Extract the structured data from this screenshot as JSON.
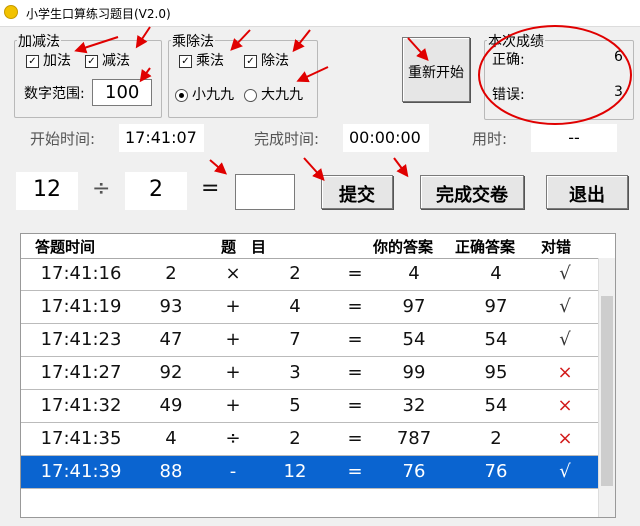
{
  "window": {
    "title": "小学生口算练习题目(V2.0)"
  },
  "addsub": {
    "group_title": "加减法",
    "add_label": "加法",
    "add_checked": true,
    "sub_label": "减法",
    "sub_checked": true,
    "range_label": "数字范围:",
    "range_value": "100"
  },
  "muldiv": {
    "group_title": "乘除法",
    "mul_label": "乘法",
    "mul_checked": true,
    "div_label": "除法",
    "div_checked": true,
    "small_label": "小九九",
    "small_selected": true,
    "big_label": "大九九",
    "big_selected": false
  },
  "restart_label": "重新开始",
  "score": {
    "group_title": "本次成绩",
    "correct_label": "正确:",
    "correct_value": "6",
    "wrong_label": "错误:",
    "wrong_value": "3"
  },
  "times": {
    "start_label": "开始时间:",
    "start_value": "17:41:07",
    "finish_label": "完成时间:",
    "finish_value": "00:00:00",
    "used_label": "用时:",
    "used_value": "--"
  },
  "question": {
    "a": "12",
    "op": "÷",
    "b": "2",
    "eq": "=",
    "answer": ""
  },
  "buttons": {
    "submit": "提交",
    "finish": "完成交卷",
    "exit": "退出"
  },
  "table": {
    "headers": {
      "time": "答题时间",
      "question": "题　目",
      "your_answer": "你的答案",
      "correct_answer": "正确答案",
      "result": "对错"
    },
    "rows": [
      {
        "time": "17:41:16",
        "a": "2",
        "op": "×",
        "b": "2",
        "eq": "=",
        "ans": "4",
        "correct": "4",
        "mark": "√",
        "right": true
      },
      {
        "time": "17:41:19",
        "a": "93",
        "op": "+",
        "b": "4",
        "eq": "=",
        "ans": "97",
        "correct": "97",
        "mark": "√",
        "right": true
      },
      {
        "time": "17:41:23",
        "a": "47",
        "op": "+",
        "b": "7",
        "eq": "=",
        "ans": "54",
        "correct": "54",
        "mark": "√",
        "right": true
      },
      {
        "time": "17:41:27",
        "a": "92",
        "op": "+",
        "b": "3",
        "eq": "=",
        "ans": "99",
        "correct": "95",
        "mark": "×",
        "right": false
      },
      {
        "time": "17:41:32",
        "a": "49",
        "op": "+",
        "b": "5",
        "eq": "=",
        "ans": "32",
        "correct": "54",
        "mark": "×",
        "right": false
      },
      {
        "time": "17:41:35",
        "a": "4",
        "op": "÷",
        "b": "2",
        "eq": "=",
        "ans": "787",
        "correct": "2",
        "mark": "×",
        "right": false
      },
      {
        "time": "17:41:39",
        "a": "88",
        "op": "-",
        "b": "12",
        "eq": "=",
        "ans": "76",
        "correct": "76",
        "mark": "√",
        "right": true,
        "selected": true
      }
    ]
  },
  "colors": {
    "annotation": "#e00000",
    "selection": "#0a64d0",
    "wrong_mark": "#d21a1a"
  }
}
